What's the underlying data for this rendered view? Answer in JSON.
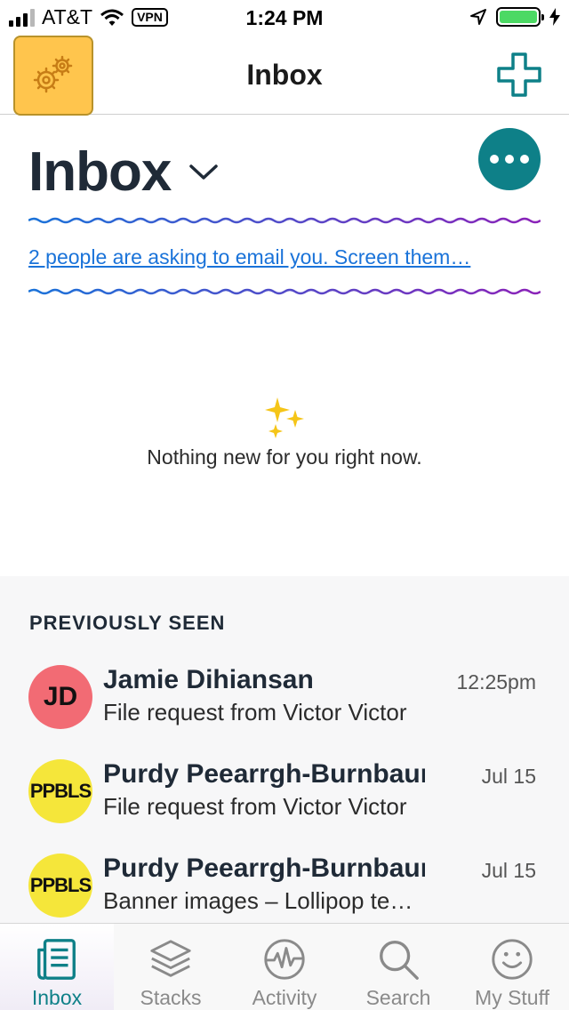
{
  "status_bar": {
    "carrier": "AT&T",
    "vpn_label": "VPN",
    "time": "1:24 PM"
  },
  "nav": {
    "title": "Inbox",
    "settings_icon": "gears-icon",
    "compose_icon": "plus-icon"
  },
  "header": {
    "title": "Inbox",
    "more_icon": "more-dots-icon"
  },
  "screener": {
    "link_text": "2 people are asking to email you. Screen them…"
  },
  "empty_state": {
    "icon": "sparkles-icon",
    "message": "Nothing new for you right now."
  },
  "previously_seen": {
    "title": "PREVIOUSLY SEEN",
    "items": [
      {
        "initials": "JD",
        "sender": "Jamie Dihiansan",
        "snippet": "File request from Victor Victor",
        "date": "12:25pm",
        "avatar_color": "#f26b74"
      },
      {
        "initials": "PPBLS",
        "sender": "Purdy Peearrgh-Burnbaum",
        "snippet": "File request from Victor Victor",
        "date": "Jul 15",
        "avatar_color": "#f5e63a"
      },
      {
        "initials": "PPBLS",
        "sender": "Purdy Peearrgh-Burnbaum",
        "snippet": "Banner images – Lollipop team",
        "date": "Jul 15",
        "avatar_color": "#f5e63a"
      }
    ]
  },
  "tab_bar": {
    "tabs": [
      {
        "label": "Inbox",
        "icon": "inbox-icon",
        "active": true
      },
      {
        "label": "Stacks",
        "icon": "stacks-icon",
        "active": false
      },
      {
        "label": "Activity",
        "icon": "activity-icon",
        "active": false
      },
      {
        "label": "Search",
        "icon": "search-icon",
        "active": false
      },
      {
        "label": "My Stuff",
        "icon": "smiley-icon",
        "active": false
      }
    ]
  },
  "colors": {
    "accent": "#0e8088",
    "settings_button": "#ffc54d",
    "link": "#1a73d9",
    "battery": "#4cd964"
  }
}
